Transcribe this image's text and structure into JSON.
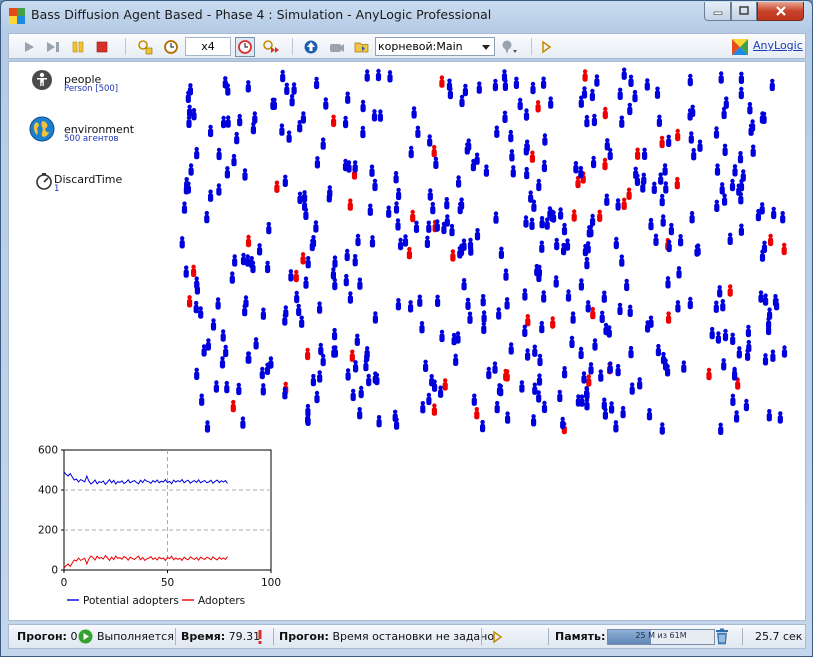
{
  "window": {
    "title": "Bass Diffusion Agent Based - Phase 4 : Simulation - AnyLogic Professional"
  },
  "toolbar": {
    "speed": "x4",
    "agent_selector": "корневой:Main",
    "logo_label": "AnyLogic"
  },
  "palette": {
    "people": {
      "name": "people",
      "sub": "Person [500]"
    },
    "environment": {
      "name": "environment",
      "sub": "500 агентов"
    },
    "discard_time": {
      "name": "DiscardTime",
      "sub": "1"
    }
  },
  "colors": {
    "potential": "#0000dd",
    "adopter": "#ee0000",
    "accent": "#1d34b5"
  },
  "chart_data": {
    "type": "line",
    "title": "",
    "xlabel": "",
    "ylabel": "",
    "xlim": [
      0,
      100
    ],
    "ylim": [
      0,
      600
    ],
    "xticks": [
      "0",
      "50",
      "100"
    ],
    "yticks": [
      "0",
      "200",
      "400",
      "600"
    ],
    "grid": true,
    "legend": "bottom",
    "x": [
      0,
      1,
      2,
      3,
      4,
      5,
      6,
      7,
      8,
      9,
      10,
      11,
      12,
      13,
      14,
      15,
      16,
      17,
      18,
      19,
      20,
      21,
      22,
      23,
      24,
      25,
      26,
      27,
      28,
      29,
      30,
      31,
      32,
      33,
      34,
      35,
      36,
      37,
      38,
      39,
      40,
      41,
      42,
      43,
      44,
      45,
      46,
      47,
      48,
      49,
      50,
      51,
      52,
      53,
      54,
      55,
      56,
      57,
      58,
      59,
      60,
      61,
      62,
      63,
      64,
      65,
      66,
      67,
      68,
      69,
      70,
      71,
      72,
      73,
      74,
      75,
      76,
      77,
      78,
      79
    ],
    "series": [
      {
        "name": "Potential adopters",
        "color": "#0000dd",
        "values": [
          490,
          478,
          470,
          482,
          465,
          450,
          455,
          440,
          452,
          447,
          441,
          470,
          445,
          430,
          438,
          450,
          431,
          442,
          437,
          445,
          428,
          440,
          452,
          436,
          448,
          430,
          442,
          438,
          446,
          432,
          439,
          451,
          436,
          443,
          447,
          438,
          431,
          449,
          437,
          452,
          444,
          441,
          433,
          447,
          439,
          450,
          436,
          444,
          440,
          452,
          437,
          443,
          431,
          449,
          439,
          447,
          441,
          452,
          436,
          444,
          449,
          434,
          442,
          447,
          438,
          451,
          436,
          443,
          447,
          436,
          441,
          449,
          434,
          443,
          450,
          437,
          446,
          440,
          447,
          433
        ]
      },
      {
        "name": "Adopters",
        "color": "#ee0000",
        "values": [
          10,
          22,
          30,
          18,
          35,
          50,
          45,
          60,
          48,
          53,
          59,
          30,
          55,
          70,
          62,
          50,
          69,
          58,
          63,
          55,
          72,
          60,
          48,
          64,
          52,
          70,
          58,
          62,
          54,
          68,
          61,
          49,
          64,
          57,
          53,
          62,
          69,
          51,
          63,
          48,
          56,
          59,
          67,
          53,
          61,
          50,
          64,
          56,
          60,
          48,
          63,
          57,
          69,
          51,
          61,
          53,
          59,
          48,
          64,
          56,
          51,
          66,
          58,
          53,
          62,
          49,
          64,
          57,
          53,
          64,
          59,
          51,
          66,
          57,
          50,
          63,
          54,
          60,
          53,
          67
        ]
      }
    ]
  },
  "statusbar": {
    "run_label": "Прогон:",
    "run_value": "0",
    "run_state": "Выполняется",
    "time_label": "Время:",
    "time_value": "79.31",
    "stop_label": "Прогон:",
    "stop_value": "Время остановки не задано",
    "memory_label": "Память:",
    "memory_text": "25 M из 61M",
    "memory_fraction": 0.41,
    "elapsed": "25.7 сек"
  }
}
